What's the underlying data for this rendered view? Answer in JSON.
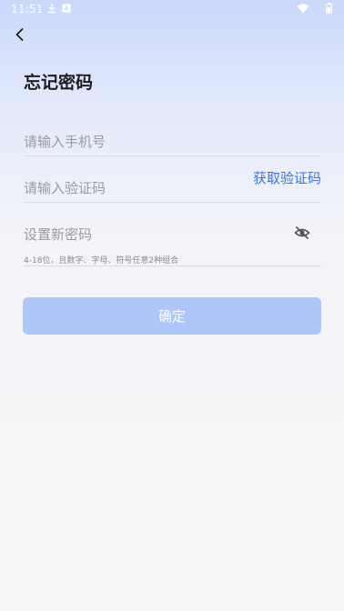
{
  "status_bar": {
    "time": "11:51"
  },
  "header": {
    "title": "忘记密码"
  },
  "form": {
    "phone": {
      "placeholder": "请输入手机号",
      "value": ""
    },
    "code": {
      "placeholder": "请输入验证码",
      "value": "",
      "get_code_label": "获取验证码"
    },
    "password": {
      "placeholder": "设置新密码",
      "value": "",
      "hint": "4-18位，且数字、字母、符号任意2种组合"
    }
  },
  "confirm_label": "确定",
  "icons": [
    "download-icon",
    "notification-a-icon",
    "wifi-icon",
    "battery-icon",
    "back-arrow-icon",
    "eye-off-icon"
  ],
  "colors": {
    "accent": "#3f73e0",
    "button_disabled": "#afc6fb"
  }
}
